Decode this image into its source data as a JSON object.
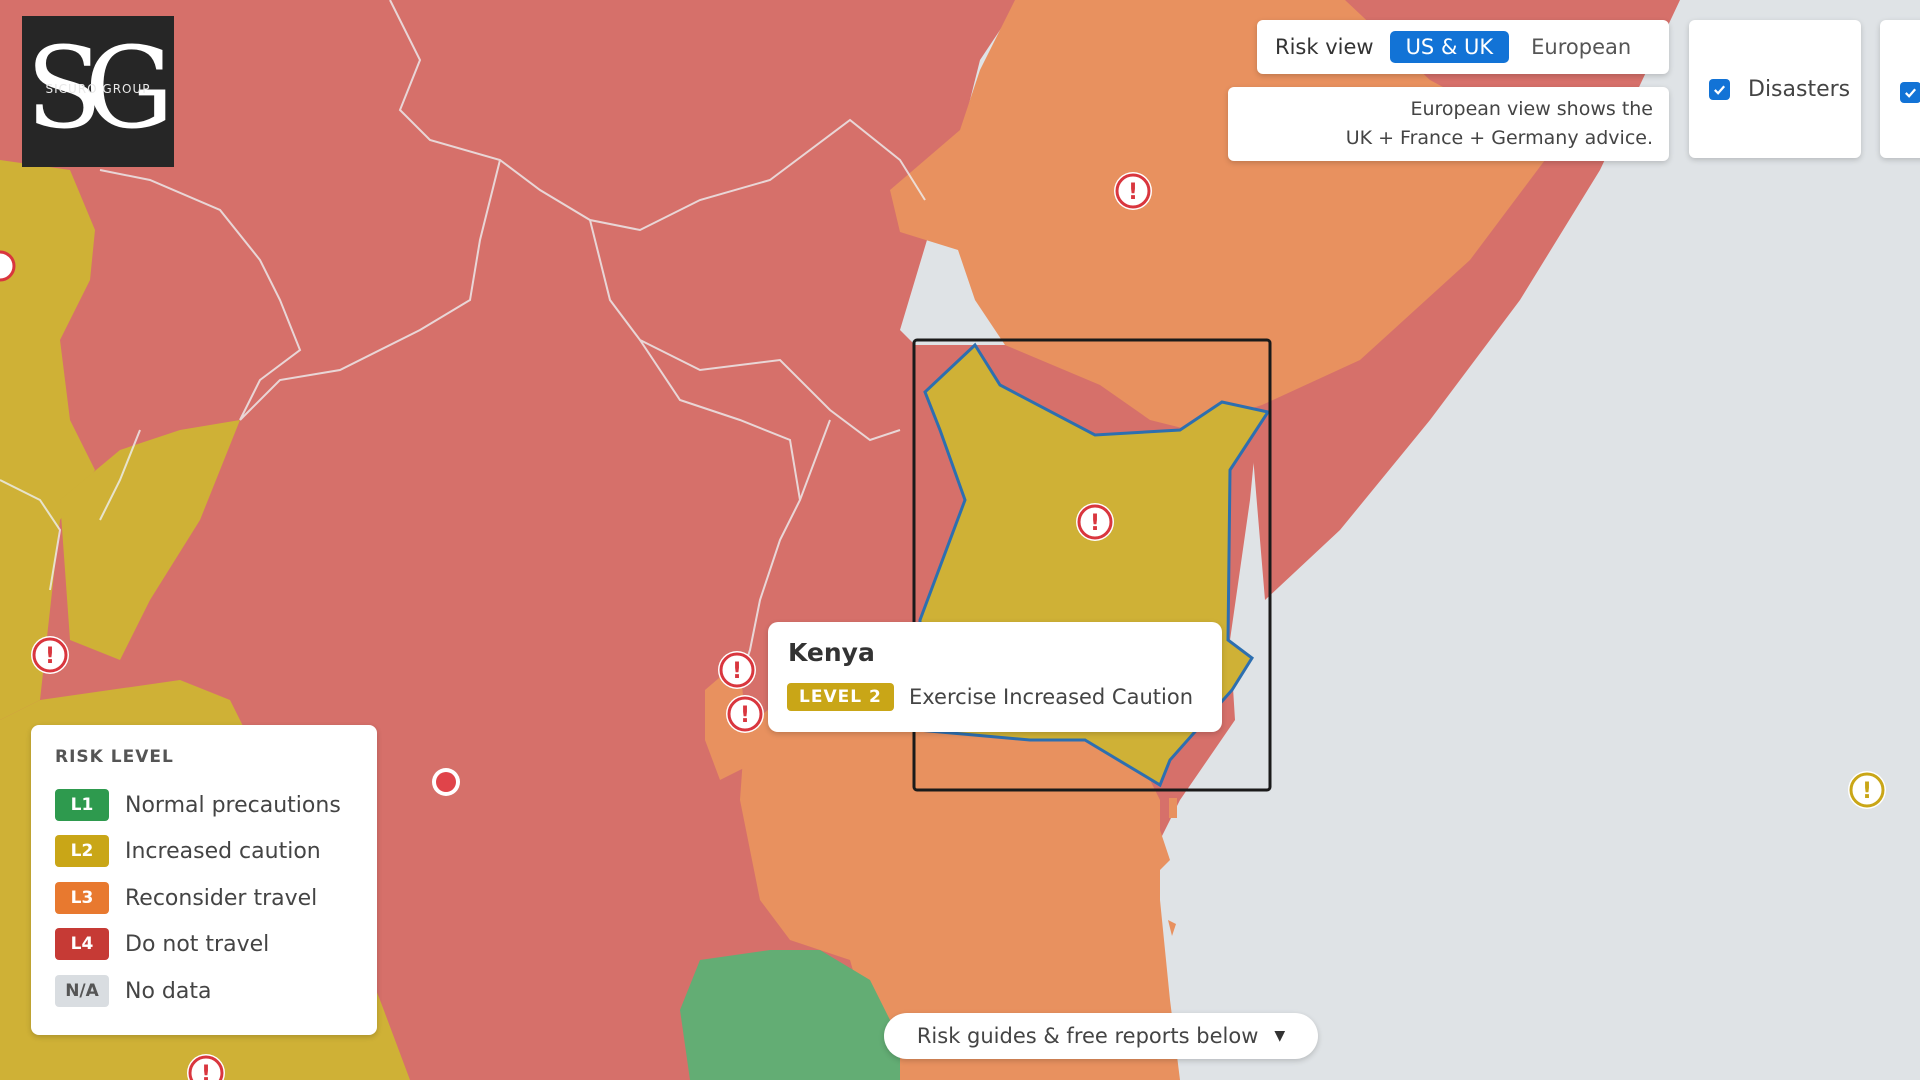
{
  "logo": {
    "monogram": "SG",
    "wordmark": "SICURO GROUP"
  },
  "risk_view": {
    "label": "Risk view",
    "options": [
      "US & UK",
      "European"
    ],
    "selected": "US & UK"
  },
  "view_note": {
    "line1": "European view shows the",
    "line2": "UK + France + Germany advice."
  },
  "layers": {
    "disasters_label": "Disasters",
    "disasters_checked": true,
    "second_checked": true
  },
  "tooltip": {
    "country": "Kenya",
    "level_badge": "LEVEL 2",
    "level_text": "Exercise Increased Caution"
  },
  "legend": {
    "title": "RISK LEVEL",
    "items": [
      {
        "code": "L1",
        "label": "Normal precautions",
        "color": "#2e9a4e"
      },
      {
        "code": "L2",
        "label": "Increased caution",
        "color": "#c9a617"
      },
      {
        "code": "L3",
        "label": "Reconsider travel",
        "color": "#e8792f"
      },
      {
        "code": "L4",
        "label": "Do not travel",
        "color": "#c63a35"
      },
      {
        "code": "N/A",
        "label": "No data",
        "color": "#d9dde1"
      }
    ]
  },
  "guides_bar": {
    "label": "Risk guides & free reports below"
  },
  "map_colors": {
    "level2": "#cfb136",
    "level3": "#e8915f",
    "level4": "#d6706a",
    "level1": "#63ad74",
    "water": "#dfe3e6",
    "selection_outline": "#2d6fb0"
  }
}
